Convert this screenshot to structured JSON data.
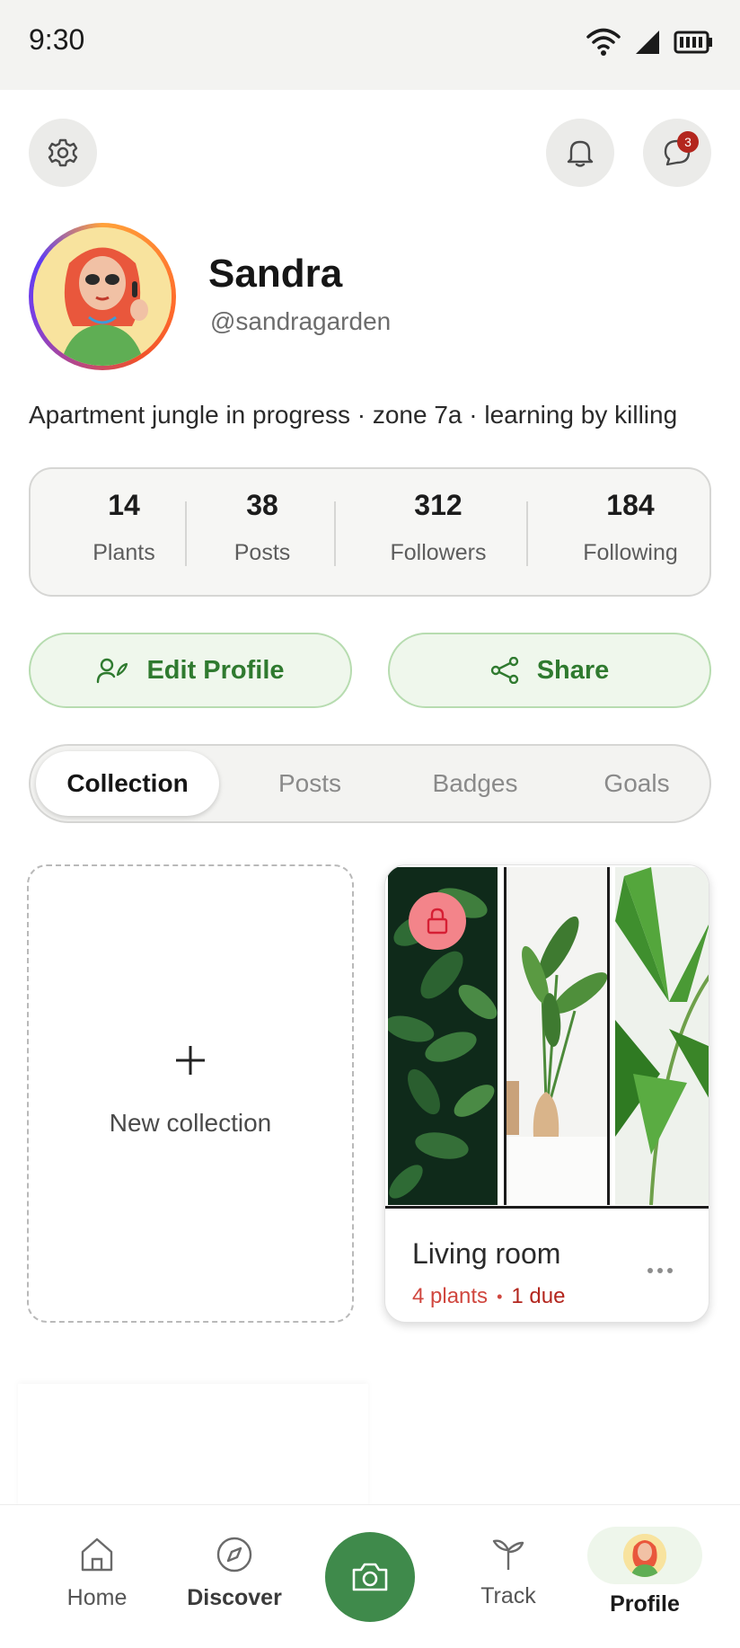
{
  "status_bar": {
    "time": "9:30"
  },
  "header": {
    "settings_icon": "gear-icon",
    "notifications_icon": "bell-icon",
    "messages_icon": "chat-icon",
    "messages_badge": "3"
  },
  "profile": {
    "name": "Sandra",
    "handle": "@sandragarden",
    "bio": "Apartment jungle in progress · zone 7a · learning by killing"
  },
  "stats": [
    {
      "value": "14",
      "label": "Plants"
    },
    {
      "value": "38",
      "label": "Posts"
    },
    {
      "value": "312",
      "label": "Followers"
    },
    {
      "value": "184",
      "label": "Following"
    }
  ],
  "actions": {
    "edit_label": "Edit Profile",
    "share_label": "Share"
  },
  "tabs": [
    {
      "label": "Collection",
      "active": true
    },
    {
      "label": "Posts",
      "active": false
    },
    {
      "label": "Badges",
      "active": false
    },
    {
      "label": "Goals",
      "active": false
    }
  ],
  "collections": {
    "new_label": "New collection",
    "items": [
      {
        "title": "Living room",
        "plants": "4 plants",
        "separator": "•",
        "due": "1 due",
        "locked": true
      }
    ]
  },
  "bottom_nav": {
    "items": [
      {
        "label": "Home",
        "icon": "home-icon"
      },
      {
        "label": "Discover",
        "icon": "compass-icon"
      },
      {
        "label": "",
        "icon": "camera-icon"
      },
      {
        "label": "Track",
        "icon": "sprout-icon"
      },
      {
        "label": "Profile",
        "icon": "avatar",
        "active": true
      }
    ]
  },
  "colors": {
    "accent_green": "#3f8a4b",
    "accent_red": "#b3261e"
  }
}
